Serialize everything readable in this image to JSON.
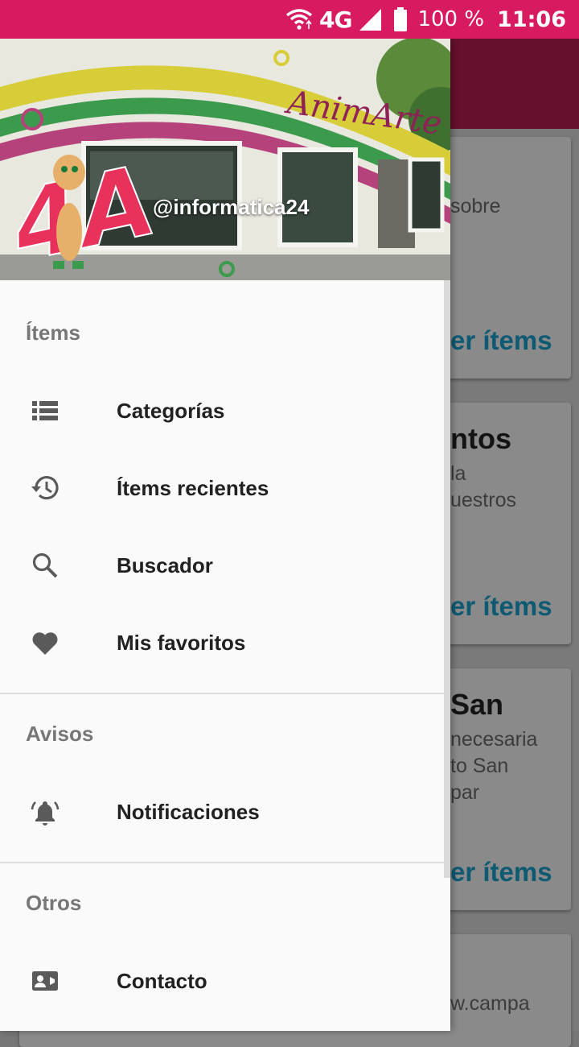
{
  "status_bar": {
    "network": "4G",
    "battery_percent": "100 %",
    "time": "11:06"
  },
  "drawer": {
    "header": {
      "account_name": "@informatica24",
      "storefront_sign": "AnimArte Land",
      "logo_text": "4A"
    },
    "sections": [
      {
        "title": "Ítems",
        "items": [
          {
            "label": "Categorías",
            "icon": "list-icon"
          },
          {
            "label": "Ítems recientes",
            "icon": "history-icon"
          },
          {
            "label": "Buscador",
            "icon": "search-icon"
          },
          {
            "label": "Mis favoritos",
            "icon": "heart-icon"
          }
        ]
      },
      {
        "title": "Avisos",
        "items": [
          {
            "label": "Notificaciones",
            "icon": "bell-icon"
          }
        ]
      },
      {
        "title": "Otros",
        "items": [
          {
            "label": "Contacto",
            "icon": "contact-card-icon"
          }
        ]
      }
    ]
  },
  "background": {
    "cards": [
      {
        "title": "",
        "lines": [
          "sobre"
        ],
        "action": "er ítems"
      },
      {
        "title": "ntos",
        "lines": [
          "la",
          "uestros"
        ],
        "action": "er ítems"
      },
      {
        "title": "San",
        "lines": [
          "necesaria",
          "to San",
          "par"
        ],
        "action": "er ítems"
      },
      {
        "title": "",
        "lines": [
          "w.campa"
        ],
        "action": ""
      }
    ]
  },
  "colors": {
    "status_bar": "#d81b60",
    "toolbar": "#880e4f",
    "accent": "#0097a7"
  }
}
